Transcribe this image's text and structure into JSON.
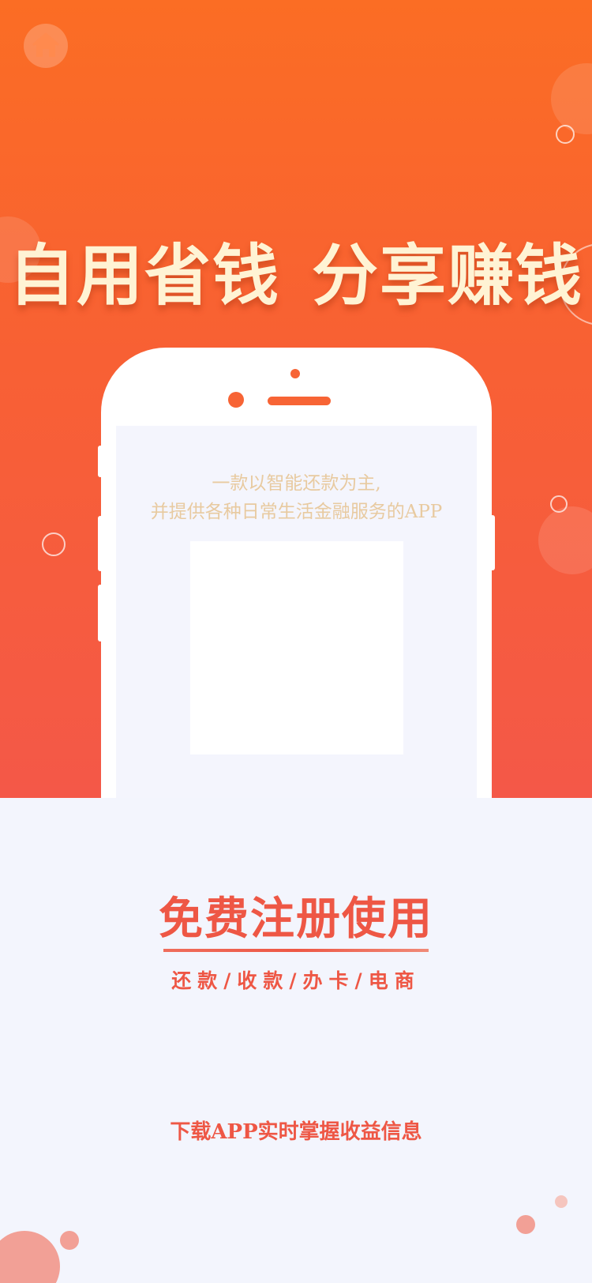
{
  "hero": {
    "headline_left": "自用省钱",
    "headline_right": "分享赚钱",
    "home_icon": "home-icon"
  },
  "phone": {
    "tagline_line1": "一款以智能还款为主,",
    "tagline_line2": "并提供各种日常生活金融服务的APP"
  },
  "cta": {
    "title": "免费注册使用",
    "services": "还款/收款/办卡/电商",
    "subtitle": "下载APP实时掌握收益信息"
  },
  "colors": {
    "hero_top": "#fb6d24",
    "hero_bottom": "#f45848",
    "accent": "#ee5745",
    "headline": "#fff3d4",
    "tagline": "#e8caa0",
    "background": "#f3f5fd"
  }
}
